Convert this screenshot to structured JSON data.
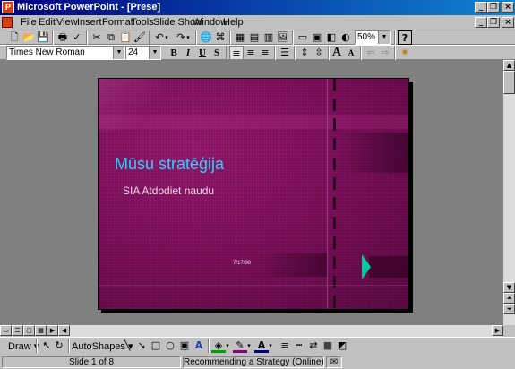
{
  "window": {
    "title": "Microsoft PowerPoint - [Prese]",
    "minimize": "_",
    "restore": "❐",
    "close": "×"
  },
  "menu": [
    "File",
    "Edit",
    "View",
    "Insert",
    "Format",
    "Tools",
    "Slide Show",
    "Window",
    "Help"
  ],
  "standard_toolbar": {
    "zoom": "50%",
    "help": "?"
  },
  "formatting_toolbar": {
    "font": "Times New Roman",
    "size": "24",
    "bold": "B",
    "italic": "I",
    "underline": "U",
    "shadow": "S",
    "grow": "A"
  },
  "slide": {
    "title": "Mūsu stratēģija",
    "subtitle": "SIA Atdodiet naudu",
    "date": "7/17/98"
  },
  "drawing_toolbar": {
    "draw": "Draw",
    "autoshapes": "AutoShapes"
  },
  "status": {
    "slide": "Slide 1 of 8",
    "design": "Recommending a Strategy (Online)"
  },
  "colors": {
    "slide_bg": "#7c0f5a",
    "title": "#33ccff",
    "accent": "#00c8a0"
  }
}
